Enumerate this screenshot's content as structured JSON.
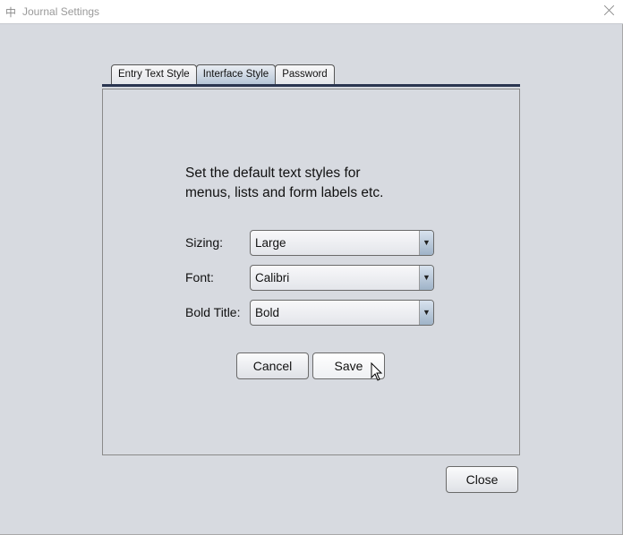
{
  "window": {
    "title": "Journal Settings",
    "app_icon": "中"
  },
  "tabs": [
    {
      "label": "Entry Text Style",
      "active": false
    },
    {
      "label": "Interface Style",
      "active": true
    },
    {
      "label": "Password",
      "active": false
    }
  ],
  "panel": {
    "description_line1": "Set the default text styles for",
    "description_line2": "menus, lists and form labels etc.",
    "fields": [
      {
        "label": "Sizing:",
        "value": "Large"
      },
      {
        "label": "Font:",
        "value": "Calibri"
      },
      {
        "label": "Bold Title:",
        "value": "Bold"
      }
    ],
    "cancel_label": "Cancel",
    "save_label": "Save"
  },
  "footer": {
    "close_label": "Close"
  },
  "icons": {
    "dropdown_arrow": "▼"
  }
}
